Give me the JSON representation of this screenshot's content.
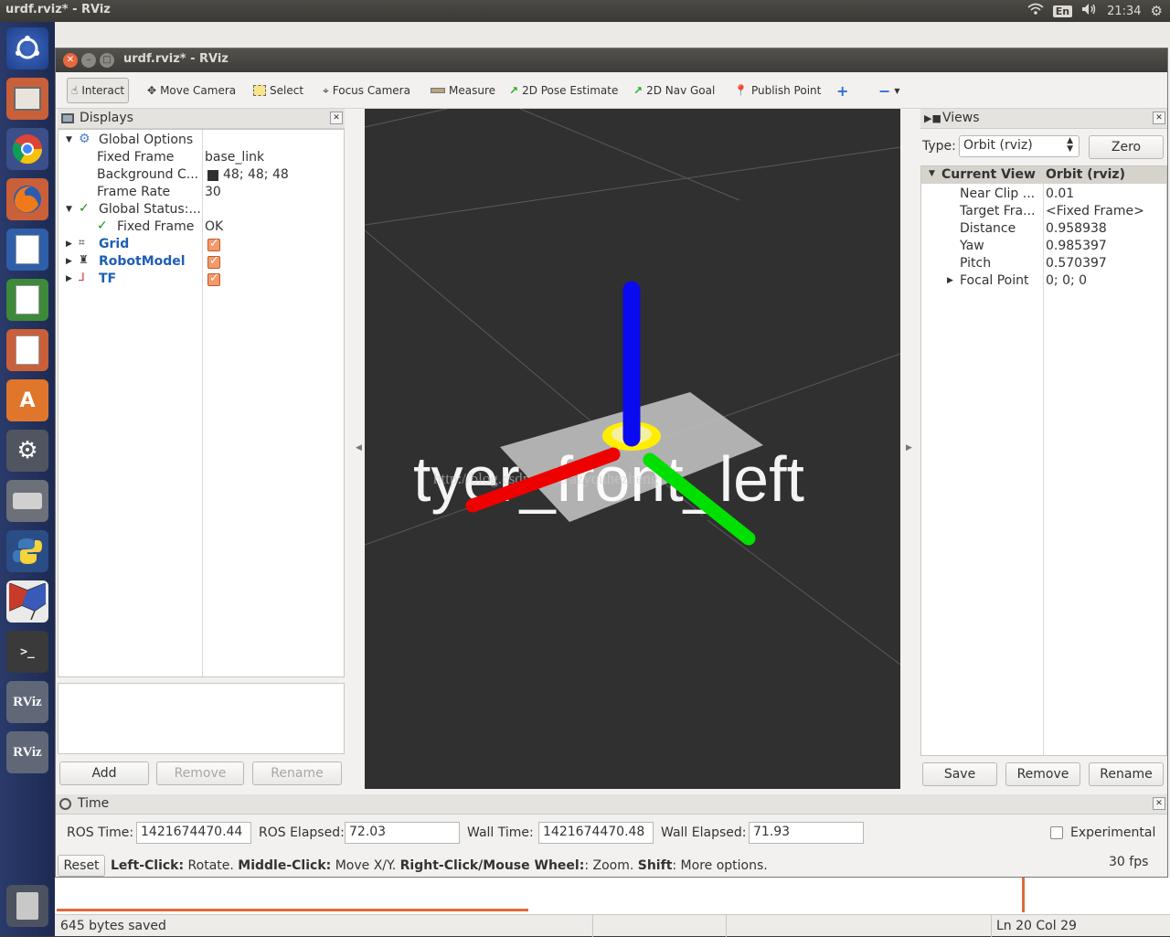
{
  "topbar": {
    "title": "urdf.rviz* - RViz",
    "lang": "En",
    "clock": "21:34"
  },
  "launcher": {
    "rviz_label_1": "RViz",
    "rviz_label_2": "RViz"
  },
  "background_editor": {
    "status_left": "645 bytes saved",
    "status_right": "Ln 20 Col 29"
  },
  "window": {
    "title": "urdf.rviz* - RViz"
  },
  "toolbar": {
    "interact": "Interact",
    "move_camera": "Move Camera",
    "select": "Select",
    "focus_camera": "Focus Camera",
    "measure": "Measure",
    "pose_estimate": "2D Pose Estimate",
    "nav_goal": "2D Nav Goal",
    "publish_point": "Publish Point"
  },
  "displays": {
    "header": "Displays",
    "global_options": "Global Options",
    "fixed_frame_label": "Fixed Frame",
    "fixed_frame_value": "base_link",
    "background_label": "Background C...",
    "background_value": "48; 48; 48",
    "background_color": "#303030",
    "frame_rate_label": "Frame Rate",
    "frame_rate_value": "30",
    "global_status": "Global Status:...",
    "fixed_frame_status_label": "Fixed Frame",
    "fixed_frame_status_value": "OK",
    "grid": "Grid",
    "robot_model": "RobotModel",
    "tf": "TF",
    "add": "Add",
    "remove": "Remove",
    "rename": "Rename"
  },
  "viewport": {
    "frame_label": "tyer_front_left",
    "watermark": "http://blog.csdn.net/crazyquhezheng"
  },
  "views": {
    "header": "Views",
    "type_label": "Type:",
    "type_value": "Orbit (rviz)",
    "zero": "Zero",
    "current_view": "Current View",
    "current_view_value": "Orbit (rviz)",
    "near_clip_label": "Near Clip ...",
    "near_clip": "0.01",
    "target_frame_label": "Target Fra...",
    "target_frame": "<Fixed Frame>",
    "distance_label": "Distance",
    "distance": "0.958938",
    "yaw_label": "Yaw",
    "yaw": "0.985397",
    "pitch_label": "Pitch",
    "pitch": "0.570397",
    "focal_point_label": "Focal Point",
    "focal_point": "0; 0; 0",
    "save": "Save",
    "remove": "Remove",
    "rename": "Rename"
  },
  "time": {
    "header": "Time",
    "ros_time_label": "ROS Time:",
    "ros_time": "1421674470.44",
    "ros_elapsed_label": "ROS Elapsed:",
    "ros_elapsed": "72.03",
    "wall_time_label": "Wall Time:",
    "wall_time": "1421674470.48",
    "wall_elapsed_label": "Wall Elapsed:",
    "wall_elapsed": "71.93",
    "experimental": "Experimental"
  },
  "status": {
    "reset": "Reset",
    "left_click_key": "Left-Click:",
    "left_click_desc": " Rotate. ",
    "middle_click_key": "Middle-Click:",
    "middle_click_desc": " Move X/Y. ",
    "right_click_key": "Right-Click/Mouse Wheel:",
    "right_click_desc": ": Zoom. ",
    "shift_key": "Shift",
    "shift_desc": ": More options.",
    "fps": "30 fps"
  }
}
